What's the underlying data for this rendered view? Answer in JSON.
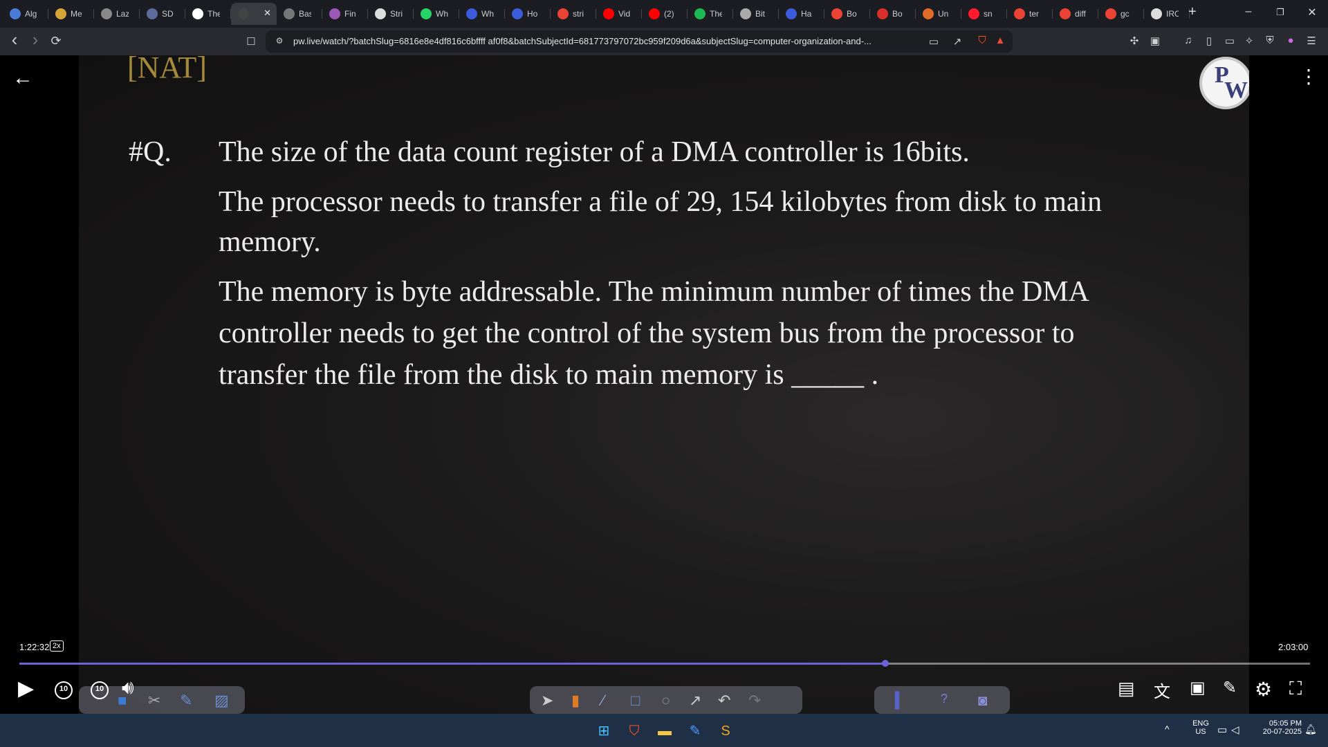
{
  "browser": {
    "tabs": [
      {
        "title": "Alg",
        "icon": "circle-icon",
        "color": "#4a7bd6"
      },
      {
        "title": "Me",
        "icon": "lightning-icon",
        "color": "#d7a43a"
      },
      {
        "title": "Laz",
        "icon": "globe-icon",
        "color": "#888888"
      },
      {
        "title": "SD",
        "icon": "book-icon",
        "color": "#5c6d9c"
      },
      {
        "title": "The",
        "icon": "w-icon",
        "color": "#ffffff"
      },
      {
        "title": "",
        "icon": "pw-icon",
        "color": "#444444",
        "active": true
      },
      {
        "title": "Bas",
        "icon": "grid-icon",
        "color": "#777777"
      },
      {
        "title": "Fin",
        "icon": "brain-icon",
        "color": "#9b59b6"
      },
      {
        "title": "Stri",
        "icon": "chatgpt-icon",
        "color": "#dddddd"
      },
      {
        "title": "Wh",
        "icon": "whatsapp-icon",
        "color": "#25d366"
      },
      {
        "title": "Wh",
        "icon": "whatsapp-icon",
        "color": "#3b5bdb"
      },
      {
        "title": "Ho",
        "icon": "bookmark-icon",
        "color": "#3b5bdb"
      },
      {
        "title": "stri",
        "icon": "google-icon",
        "color": "#ea4335"
      },
      {
        "title": "Vid",
        "icon": "youtube-icon",
        "color": "#ff0000"
      },
      {
        "title": "(2)",
        "icon": "youtube-icon",
        "color": "#ff0000"
      },
      {
        "title": "The",
        "icon": "spotify-icon",
        "color": "#1db954"
      },
      {
        "title": "Bit",
        "icon": "code-icon",
        "color": "#aaaaaa"
      },
      {
        "title": "Ha",
        "icon": "f-icon",
        "color": "#3b5bdb"
      },
      {
        "title": "Bo",
        "icon": "google-icon",
        "color": "#ea4335"
      },
      {
        "title": "Bo",
        "icon": "flag-icon",
        "color": "#d9302c"
      },
      {
        "title": "Un",
        "icon": "stack-icon",
        "color": "#e06c2a"
      },
      {
        "title": "sn",
        "icon": "opera-icon",
        "color": "#ff1b2d"
      },
      {
        "title": "ter",
        "icon": "google-icon",
        "color": "#ea4335"
      },
      {
        "title": "diff",
        "icon": "google-icon",
        "color": "#ea4335"
      },
      {
        "title": "gc",
        "icon": "google-icon",
        "color": "#ea4335"
      },
      {
        "title": "IRC",
        "icon": "image-icon",
        "color": "#dddddd"
      }
    ],
    "new_tab": "+",
    "window_controls": {
      "minimize": "–",
      "restore": "❐",
      "close": "✕"
    },
    "url": "pw.live/watch/?batchSlug=6816e8e4df816c6bffff af0f8&batchSubjectId=681773797072bc959f209d6a&subjectSlug=computer-organization-and-...",
    "icons": {
      "back": "‹",
      "forward": "›",
      "reload": "⟳",
      "bookmark": "☐"
    }
  },
  "video": {
    "tag": "[NAT]",
    "logo_letters": [
      "P",
      "W"
    ],
    "question_label": "#Q.",
    "question_lines": [
      "The size of the data count register of a DMA controller is 16bits.",
      "The processor needs to transfer a file of 29, 154 kilobytes from disk to main",
      "memory.",
      "The memory is byte addressable. The minimum number of times the DMA",
      "controller needs to get the control of the system bus from the processor to",
      "transfer the file from the disk to main memory is _____ ."
    ]
  },
  "player": {
    "current_time": "1:22:32",
    "speed": "2x",
    "duration": "2:03:00",
    "progress": 0.671,
    "rewind_seconds": "10",
    "forward_seconds": "10",
    "accent_color": "#6b63d6"
  },
  "taskbar": {
    "language": "ENG",
    "region": "US",
    "time": "05:05 PM",
    "date": "20-07-2025",
    "up_arrow": "^"
  }
}
